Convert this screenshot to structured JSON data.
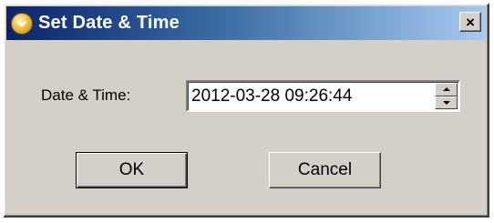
{
  "window": {
    "title": "Set Date & Time",
    "close_glyph": "×",
    "icon": "clock-icon"
  },
  "form": {
    "label": "Date & Time:",
    "datetime_value": "2012-03-28 09:26:44"
  },
  "buttons": {
    "ok_label": "OK",
    "cancel_label": "Cancel"
  },
  "colors": {
    "titlebar_start": "#0a246a",
    "titlebar_end": "#a6caf0",
    "dialog_face": "#d4d0c8"
  }
}
